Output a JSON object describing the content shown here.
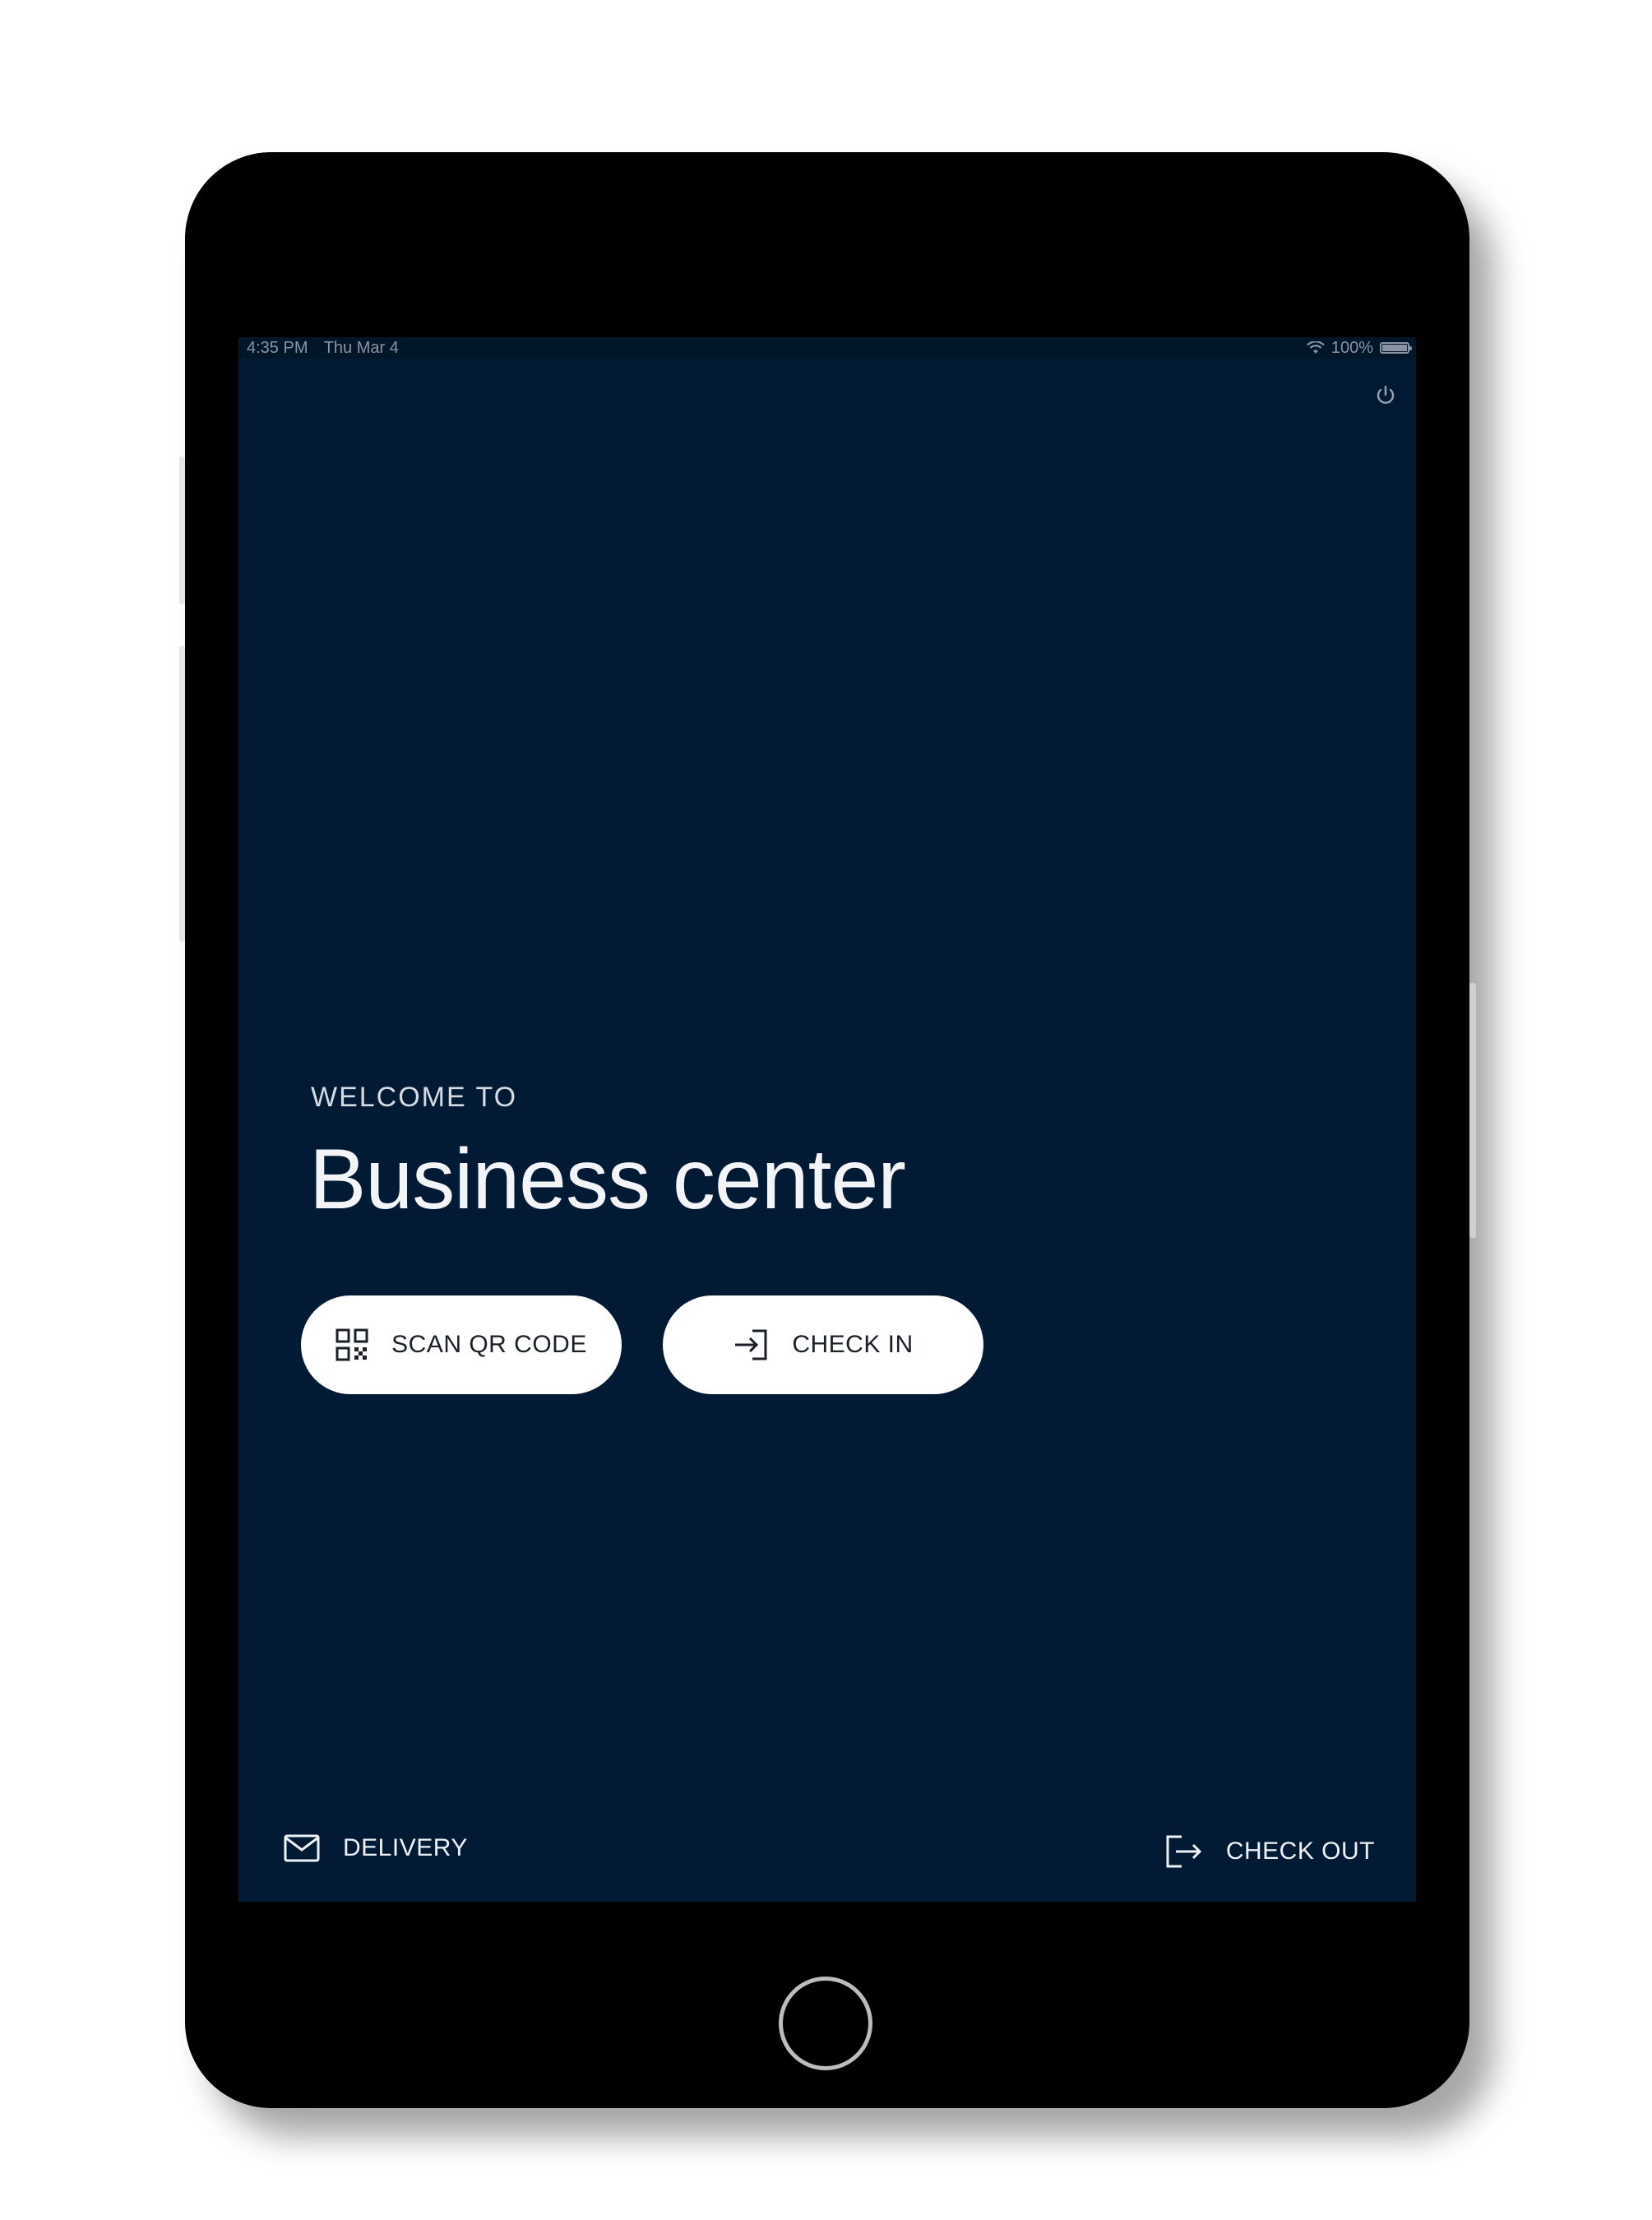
{
  "status_bar": {
    "time": "4:35 PM",
    "date": "Thu Mar 4",
    "battery": "100%",
    "battery_level": 1.0
  },
  "header": {
    "power_icon": "power-icon"
  },
  "welcome": {
    "label": "WELCOME TO",
    "title": "Business center"
  },
  "actions": {
    "scan_label": "SCAN QR CODE",
    "scan_icon": "qr-code-icon",
    "checkin_label": "CHECK IN",
    "checkin_icon": "login-arrow-icon"
  },
  "footer": {
    "delivery_label": "DELIVERY",
    "delivery_icon": "mail-icon",
    "checkout_label": "CHECK OUT",
    "checkout_icon": "logout-arrow-icon"
  },
  "colors": {
    "screen_background": "#021a33",
    "button_background": "#ffffff",
    "button_text": "#1b1f27",
    "text_light": "#f2f4f7"
  }
}
